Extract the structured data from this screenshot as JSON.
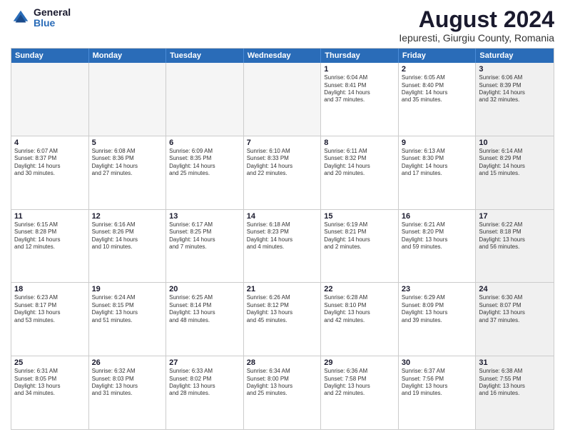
{
  "header": {
    "logo": {
      "general": "General",
      "blue": "Blue"
    },
    "title": "August 2024",
    "subtitle": "Iepuresti, Giurgiu County, Romania"
  },
  "calendar": {
    "weekdays": [
      "Sunday",
      "Monday",
      "Tuesday",
      "Wednesday",
      "Thursday",
      "Friday",
      "Saturday"
    ],
    "rows": [
      [
        {
          "day": "",
          "info": "",
          "empty": true
        },
        {
          "day": "",
          "info": "",
          "empty": true
        },
        {
          "day": "",
          "info": "",
          "empty": true
        },
        {
          "day": "",
          "info": "",
          "empty": true
        },
        {
          "day": "1",
          "info": "Sunrise: 6:04 AM\nSunset: 8:41 PM\nDaylight: 14 hours\nand 37 minutes."
        },
        {
          "day": "2",
          "info": "Sunrise: 6:05 AM\nSunset: 8:40 PM\nDaylight: 14 hours\nand 35 minutes."
        },
        {
          "day": "3",
          "info": "Sunrise: 6:06 AM\nSunset: 8:39 PM\nDaylight: 14 hours\nand 32 minutes.",
          "shaded": true
        }
      ],
      [
        {
          "day": "4",
          "info": "Sunrise: 6:07 AM\nSunset: 8:37 PM\nDaylight: 14 hours\nand 30 minutes."
        },
        {
          "day": "5",
          "info": "Sunrise: 6:08 AM\nSunset: 8:36 PM\nDaylight: 14 hours\nand 27 minutes."
        },
        {
          "day": "6",
          "info": "Sunrise: 6:09 AM\nSunset: 8:35 PM\nDaylight: 14 hours\nand 25 minutes."
        },
        {
          "day": "7",
          "info": "Sunrise: 6:10 AM\nSunset: 8:33 PM\nDaylight: 14 hours\nand 22 minutes."
        },
        {
          "day": "8",
          "info": "Sunrise: 6:11 AM\nSunset: 8:32 PM\nDaylight: 14 hours\nand 20 minutes."
        },
        {
          "day": "9",
          "info": "Sunrise: 6:13 AM\nSunset: 8:30 PM\nDaylight: 14 hours\nand 17 minutes."
        },
        {
          "day": "10",
          "info": "Sunrise: 6:14 AM\nSunset: 8:29 PM\nDaylight: 14 hours\nand 15 minutes.",
          "shaded": true
        }
      ],
      [
        {
          "day": "11",
          "info": "Sunrise: 6:15 AM\nSunset: 8:28 PM\nDaylight: 14 hours\nand 12 minutes."
        },
        {
          "day": "12",
          "info": "Sunrise: 6:16 AM\nSunset: 8:26 PM\nDaylight: 14 hours\nand 10 minutes."
        },
        {
          "day": "13",
          "info": "Sunrise: 6:17 AM\nSunset: 8:25 PM\nDaylight: 14 hours\nand 7 minutes."
        },
        {
          "day": "14",
          "info": "Sunrise: 6:18 AM\nSunset: 8:23 PM\nDaylight: 14 hours\nand 4 minutes."
        },
        {
          "day": "15",
          "info": "Sunrise: 6:19 AM\nSunset: 8:21 PM\nDaylight: 14 hours\nand 2 minutes."
        },
        {
          "day": "16",
          "info": "Sunrise: 6:21 AM\nSunset: 8:20 PM\nDaylight: 13 hours\nand 59 minutes."
        },
        {
          "day": "17",
          "info": "Sunrise: 6:22 AM\nSunset: 8:18 PM\nDaylight: 13 hours\nand 56 minutes.",
          "shaded": true
        }
      ],
      [
        {
          "day": "18",
          "info": "Sunrise: 6:23 AM\nSunset: 8:17 PM\nDaylight: 13 hours\nand 53 minutes."
        },
        {
          "day": "19",
          "info": "Sunrise: 6:24 AM\nSunset: 8:15 PM\nDaylight: 13 hours\nand 51 minutes."
        },
        {
          "day": "20",
          "info": "Sunrise: 6:25 AM\nSunset: 8:14 PM\nDaylight: 13 hours\nand 48 minutes."
        },
        {
          "day": "21",
          "info": "Sunrise: 6:26 AM\nSunset: 8:12 PM\nDaylight: 13 hours\nand 45 minutes."
        },
        {
          "day": "22",
          "info": "Sunrise: 6:28 AM\nSunset: 8:10 PM\nDaylight: 13 hours\nand 42 minutes."
        },
        {
          "day": "23",
          "info": "Sunrise: 6:29 AM\nSunset: 8:09 PM\nDaylight: 13 hours\nand 39 minutes."
        },
        {
          "day": "24",
          "info": "Sunrise: 6:30 AM\nSunset: 8:07 PM\nDaylight: 13 hours\nand 37 minutes.",
          "shaded": true
        }
      ],
      [
        {
          "day": "25",
          "info": "Sunrise: 6:31 AM\nSunset: 8:05 PM\nDaylight: 13 hours\nand 34 minutes."
        },
        {
          "day": "26",
          "info": "Sunrise: 6:32 AM\nSunset: 8:03 PM\nDaylight: 13 hours\nand 31 minutes."
        },
        {
          "day": "27",
          "info": "Sunrise: 6:33 AM\nSunset: 8:02 PM\nDaylight: 13 hours\nand 28 minutes."
        },
        {
          "day": "28",
          "info": "Sunrise: 6:34 AM\nSunset: 8:00 PM\nDaylight: 13 hours\nand 25 minutes."
        },
        {
          "day": "29",
          "info": "Sunrise: 6:36 AM\nSunset: 7:58 PM\nDaylight: 13 hours\nand 22 minutes."
        },
        {
          "day": "30",
          "info": "Sunrise: 6:37 AM\nSunset: 7:56 PM\nDaylight: 13 hours\nand 19 minutes."
        },
        {
          "day": "31",
          "info": "Sunrise: 6:38 AM\nSunset: 7:55 PM\nDaylight: 13 hours\nand 16 minutes.",
          "shaded": true
        }
      ]
    ]
  }
}
